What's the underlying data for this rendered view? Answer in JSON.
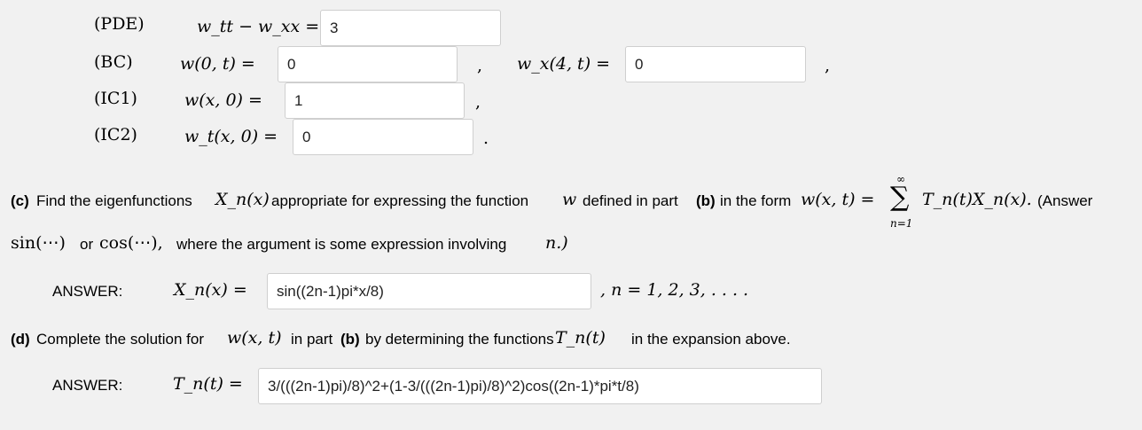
{
  "pde": {
    "label": "(PDE)",
    "lhs": "w_tt − w_xx =",
    "value": "3"
  },
  "bc": {
    "label": "(BC)",
    "left_lhs": "w(0, t) =",
    "left_value": "0",
    "comma1": ",",
    "right_lhs": "w_x(4, t) =",
    "right_value": "0",
    "comma2": ","
  },
  "ic1": {
    "label": "(IC1)",
    "lhs": "w(x, 0) =",
    "value": "1",
    "comma": ","
  },
  "ic2": {
    "label": "(IC2)",
    "lhs": "w_t(x, 0) =",
    "value": "0",
    "period": "."
  },
  "part_c": {
    "tag": "(c)",
    "text1": "Find the eigenfunctions",
    "Xn": "X_n(x)",
    "text2": "appropriate for expressing the function",
    "w": "w",
    "text3": "defined in part",
    "part_b": "(b)",
    "text4": "in the form",
    "formula_lhs": "w(x, t) =",
    "sum_top": "∞",
    "sum_bottom": "n=1",
    "formula_rhs": "T_n(t)X_n(x).",
    "text5": "(Answer",
    "sin": "sin(⋯)",
    "or": "or",
    "cos": "cos(⋯),",
    "text6": "where the argument is some expression involving",
    "n": "n.)"
  },
  "answer_c": {
    "label": "ANSWER:",
    "lhs": "X_n(x) =",
    "value": "sin((2n-1)pi*x/8)",
    "suffix": ", n = 1, 2, 3, . . . ."
  },
  "part_d": {
    "tag": "(d)",
    "text1": "Complete the solution for",
    "w": "w(x, t)",
    "text2": "in part",
    "part_b": "(b)",
    "text3": "by determining the functions",
    "Tn": "T_n(t)",
    "text4": "in the expansion above."
  },
  "answer_d": {
    "label": "ANSWER:",
    "lhs": "T_n(t) =",
    "value": "3/(((2n-1)pi)/8)^2+(1-3/(((2n-1)pi)/8)^2)cos((2n-1)*pi*t/8)"
  }
}
